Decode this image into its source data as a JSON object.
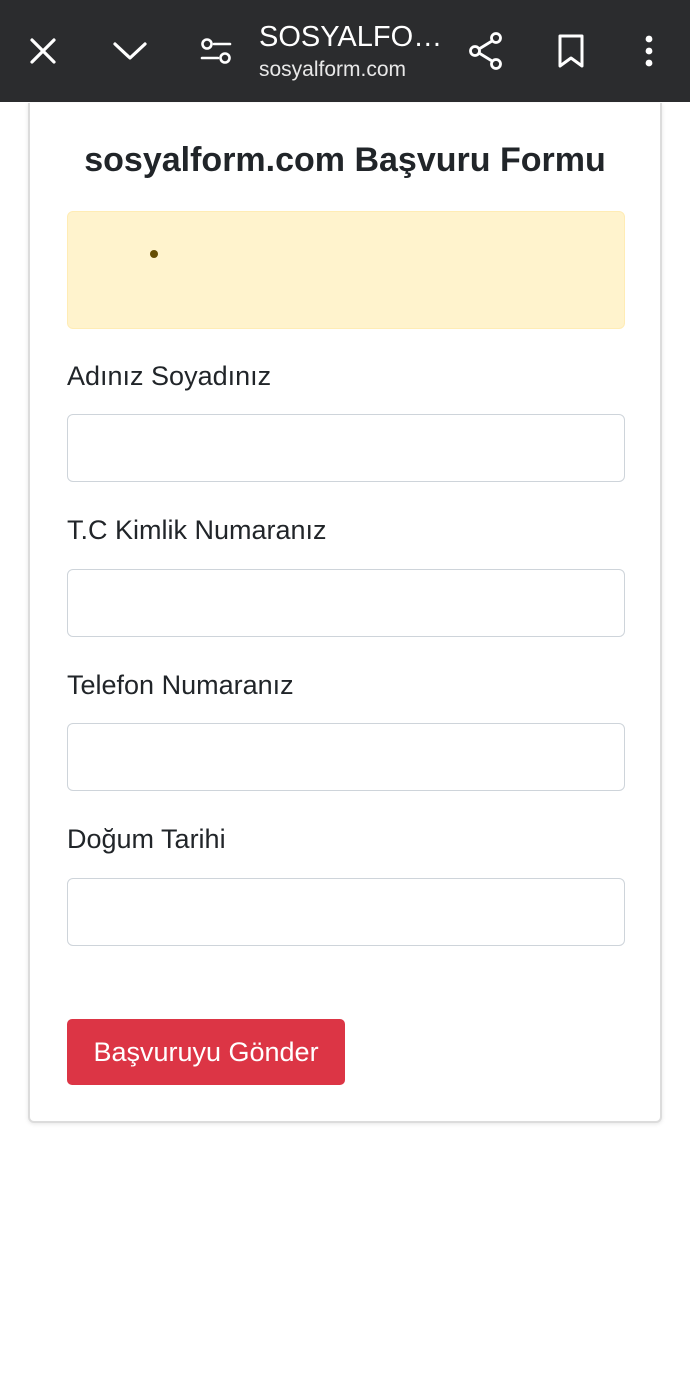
{
  "browser": {
    "title": "SOSYALFORM.COM",
    "url": "sosyalform.com"
  },
  "form": {
    "title": "sosyalform.com Başvuru Formu",
    "alert_items": [
      ""
    ],
    "fields": [
      {
        "label": "Adınız Soyadınız",
        "value": ""
      },
      {
        "label": "T.C Kimlik Numaranız",
        "value": ""
      },
      {
        "label": "Telefon Numaranız",
        "value": ""
      },
      {
        "label": "Doğum Tarihi",
        "value": ""
      }
    ],
    "submit_label": "Başvuruyu Gönder"
  },
  "colors": {
    "toolbar": "#2b2c2e",
    "alert_bg": "#fff3cd",
    "submit_bg": "#dc3545"
  }
}
